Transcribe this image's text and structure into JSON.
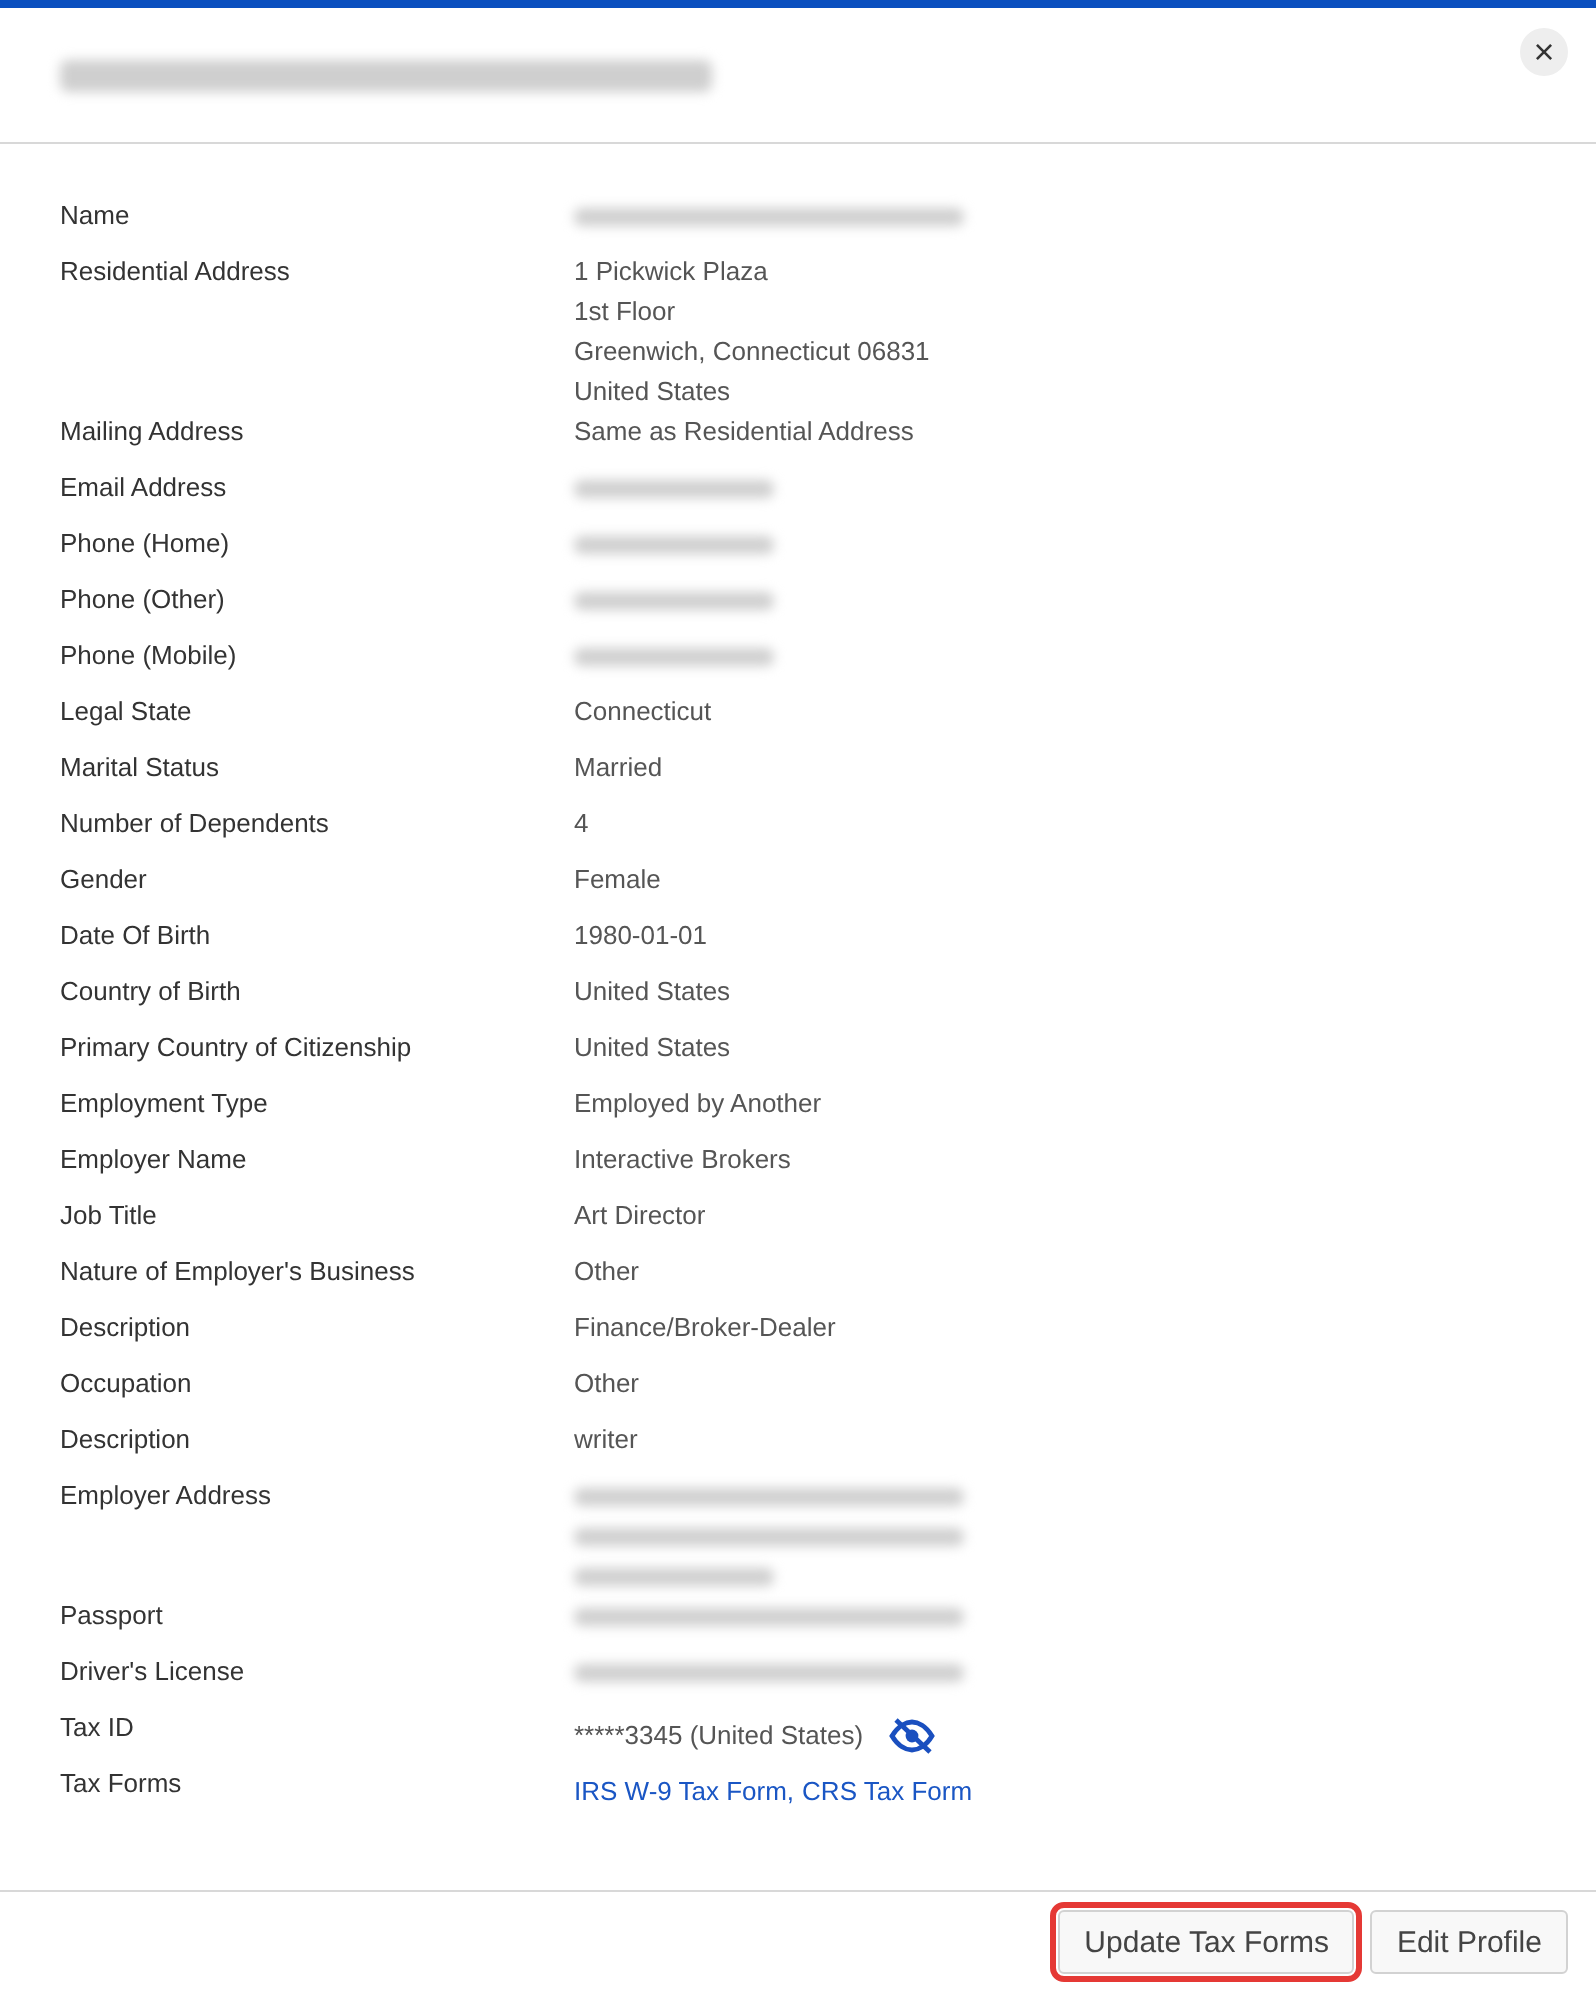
{
  "dialog": {
    "title": {
      "kind": "redacted",
      "lines": [
        {
          "wide": true
        }
      ]
    },
    "close_label": "×"
  },
  "rows": [
    {
      "label": "Name",
      "kind": "redacted",
      "lines": [
        {
          "wide": true
        }
      ]
    },
    {
      "label": "Residential Address",
      "kind": "text",
      "lines": [
        "1 Pickwick Plaza",
        "1st Floor",
        "Greenwich, Connecticut 06831",
        "United States"
      ]
    },
    {
      "label": "Mailing Address",
      "kind": "text",
      "lines": [
        "Same as Residential Address"
      ]
    },
    {
      "label": "Email Address",
      "kind": "redacted",
      "lines": [
        {
          "wide": false
        }
      ]
    },
    {
      "label": "Phone (Home)",
      "kind": "redacted",
      "lines": [
        {
          "wide": false
        }
      ]
    },
    {
      "label": "Phone (Other)",
      "kind": "redacted",
      "lines": [
        {
          "wide": false
        }
      ]
    },
    {
      "label": "Phone (Mobile)",
      "kind": "redacted",
      "lines": [
        {
          "wide": false
        }
      ]
    },
    {
      "label": "Legal State",
      "kind": "text",
      "lines": [
        "Connecticut"
      ]
    },
    {
      "label": "Marital Status",
      "kind": "text",
      "lines": [
        "Married"
      ]
    },
    {
      "label": "Number of Dependents",
      "kind": "text",
      "lines": [
        "4"
      ]
    },
    {
      "label": "Gender",
      "kind": "text",
      "lines": [
        "Female"
      ]
    },
    {
      "label": "Date Of Birth",
      "kind": "text",
      "lines": [
        "1980-01-01"
      ]
    },
    {
      "label": "Country of Birth",
      "kind": "text",
      "lines": [
        "United States"
      ]
    },
    {
      "label": "Primary Country of Citizenship",
      "kind": "text",
      "lines": [
        "United States"
      ]
    },
    {
      "label": "Employment Type",
      "kind": "text",
      "lines": [
        "Employed by Another"
      ]
    },
    {
      "label": "Employer Name",
      "kind": "text",
      "lines": [
        "Interactive Brokers"
      ]
    },
    {
      "label": "Job Title",
      "kind": "text",
      "lines": [
        "Art Director"
      ]
    },
    {
      "label": "Nature of Employer's Business",
      "kind": "text",
      "lines": [
        "Other"
      ]
    },
    {
      "label": "Description",
      "kind": "text",
      "lines": [
        "Finance/Broker-Dealer"
      ]
    },
    {
      "label": "Occupation",
      "kind": "text",
      "lines": [
        "Other"
      ]
    },
    {
      "label": "Description",
      "kind": "text",
      "lines": [
        "writer"
      ]
    },
    {
      "label": "Employer Address",
      "kind": "redacted",
      "lines": [
        {
          "wide": true
        },
        {
          "wide": true
        },
        {
          "wide": false
        }
      ]
    },
    {
      "label": "Passport",
      "kind": "redacted",
      "lines": [
        {
          "wide": true
        }
      ]
    },
    {
      "label": "Driver's License",
      "kind": "redacted",
      "lines": [
        {
          "wide": true
        }
      ]
    },
    {
      "label": "Tax ID",
      "kind": "masked",
      "lines": [
        "*****3345 (United States)"
      ]
    },
    {
      "label": "Tax Forms",
      "kind": "links",
      "lines": [
        "IRS W-9 Tax Form,",
        "CRS Tax Form"
      ]
    }
  ],
  "buttons": [
    {
      "label": "Update Tax Forms",
      "highlighted": true
    },
    {
      "label": "Edit Profile",
      "highlighted": false
    }
  ]
}
